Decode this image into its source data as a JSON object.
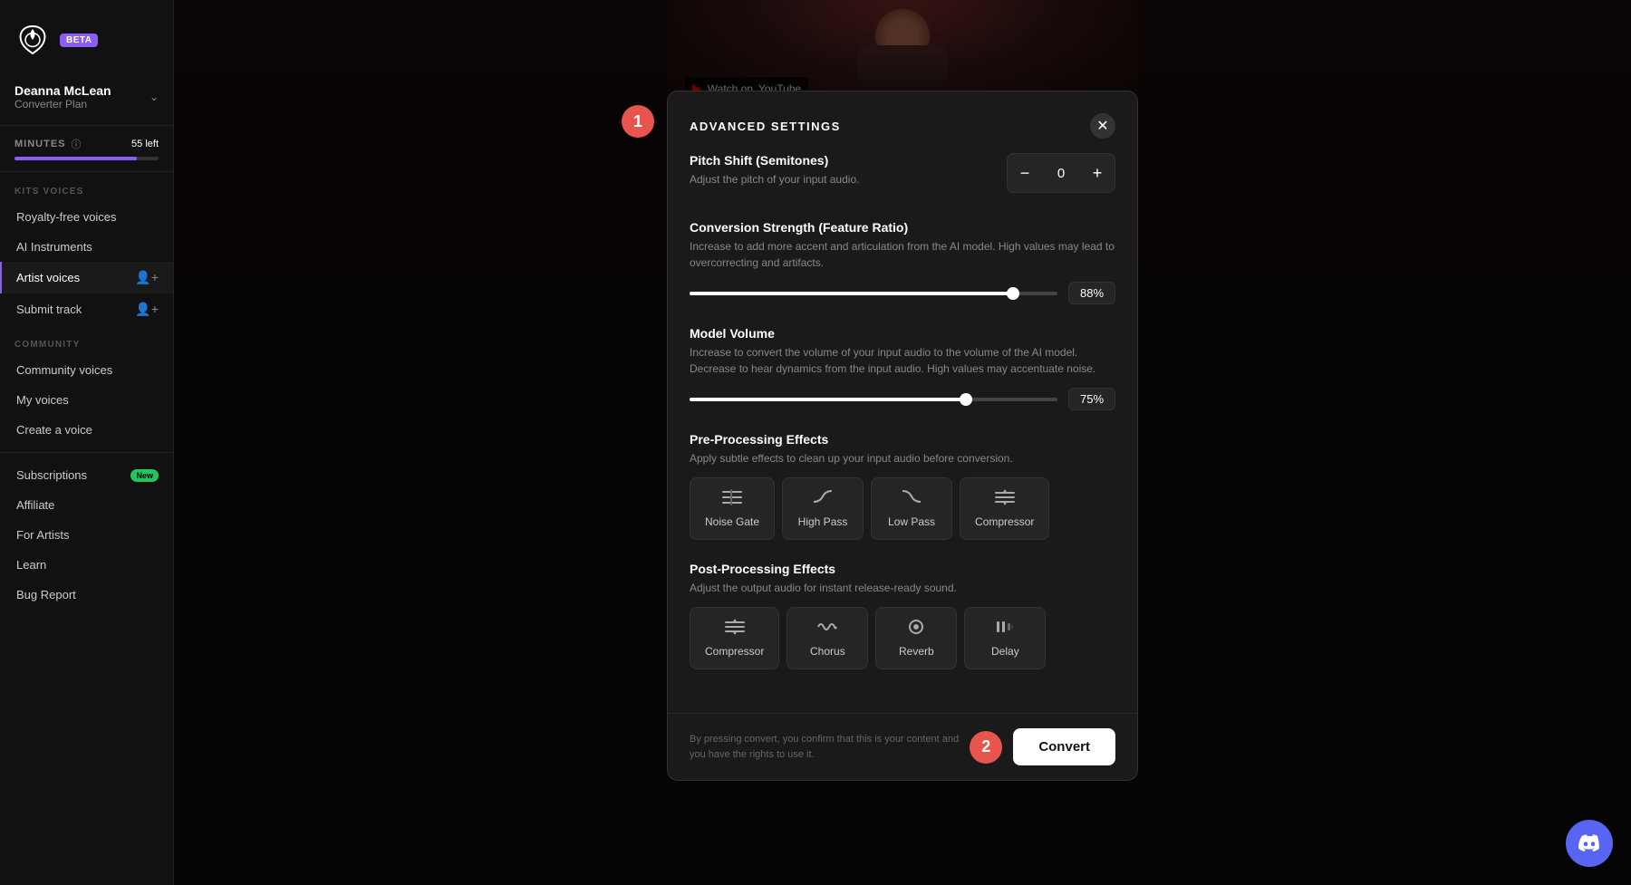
{
  "sidebar": {
    "beta_label": "BETA",
    "user": {
      "name": "Deanna McLean",
      "plan": "Converter Plan"
    },
    "minutes": {
      "label": "MINUTES",
      "left_text": "55 left",
      "progress_percent": 85
    },
    "kits_voices_label": "KITS VOICES",
    "nav_items_kits": [
      {
        "id": "royalty-free",
        "label": "Royalty-free voices",
        "active": false
      },
      {
        "id": "ai-instruments",
        "label": "AI Instruments",
        "active": false
      },
      {
        "id": "artist-voices",
        "label": "Artist voices",
        "active": true
      },
      {
        "id": "submit-track",
        "label": "Submit track",
        "active": false
      }
    ],
    "community_label": "COMMUNITY",
    "nav_items_community": [
      {
        "id": "community-voices",
        "label": "Community voices",
        "active": false
      },
      {
        "id": "my-voices",
        "label": "My voices",
        "active": false
      },
      {
        "id": "create-voice",
        "label": "Create a voice",
        "active": false
      }
    ],
    "nav_items_bottom": [
      {
        "id": "subscriptions",
        "label": "Subscriptions",
        "badge": "New"
      },
      {
        "id": "affiliate",
        "label": "Affiliate",
        "badge": null
      },
      {
        "id": "for-artists",
        "label": "For Artists",
        "badge": null
      },
      {
        "id": "learn",
        "label": "Learn",
        "badge": null
      },
      {
        "id": "bug-report",
        "label": "Bug Report",
        "badge": null
      }
    ]
  },
  "modal": {
    "step1_number": "1",
    "title": "ADVANCED SETTINGS",
    "pitch_shift": {
      "label": "Pitch Shift (Semitones)",
      "desc": "Adjust the pitch of your input audio.",
      "value": "0"
    },
    "conversion_strength": {
      "label": "Conversion Strength (Feature Ratio)",
      "desc": "Increase to add more accent and articulation from the AI model. High values may lead to overcorrecting and artifacts.",
      "value": "88%",
      "percent": 88
    },
    "model_volume": {
      "label": "Model Volume",
      "desc": "Increase to convert the volume of your input audio to the volume of the AI model. Decrease to hear dynamics from the input audio. High values may accentuate noise.",
      "value": "75%",
      "percent": 75
    },
    "pre_processing": {
      "label": "Pre-Processing Effects",
      "desc": "Apply subtle effects to clean up your input audio before conversion.",
      "effects": [
        {
          "id": "noise-gate",
          "label": "Noise Gate",
          "icon": "≡≡"
        },
        {
          "id": "high-pass",
          "label": "High Pass",
          "icon": "⌒"
        },
        {
          "id": "low-pass",
          "label": "Low Pass",
          "icon": "⌢"
        },
        {
          "id": "compressor-pre",
          "label": "Compressor",
          "icon": "↕≡"
        }
      ]
    },
    "post_processing": {
      "label": "Post-Processing Effects",
      "desc": "Adjust the output audio for instant release-ready sound.",
      "effects": [
        {
          "id": "compressor-post",
          "label": "Compressor",
          "icon": "↕≡"
        },
        {
          "id": "chorus",
          "label": "Chorus",
          "icon": "∿"
        },
        {
          "id": "reverb",
          "label": "Reverb",
          "icon": "◎"
        },
        {
          "id": "delay",
          "label": "Delay",
          "icon": "⊪"
        }
      ]
    },
    "footer_disclaimer": "By pressing convert, you confirm that this is your content and you have the rights to use it.",
    "step2_number": "2",
    "convert_label": "Convert"
  },
  "video": {
    "watch_on": "Watch on",
    "platform": "YouTube"
  },
  "discord": {
    "icon": "discord"
  }
}
